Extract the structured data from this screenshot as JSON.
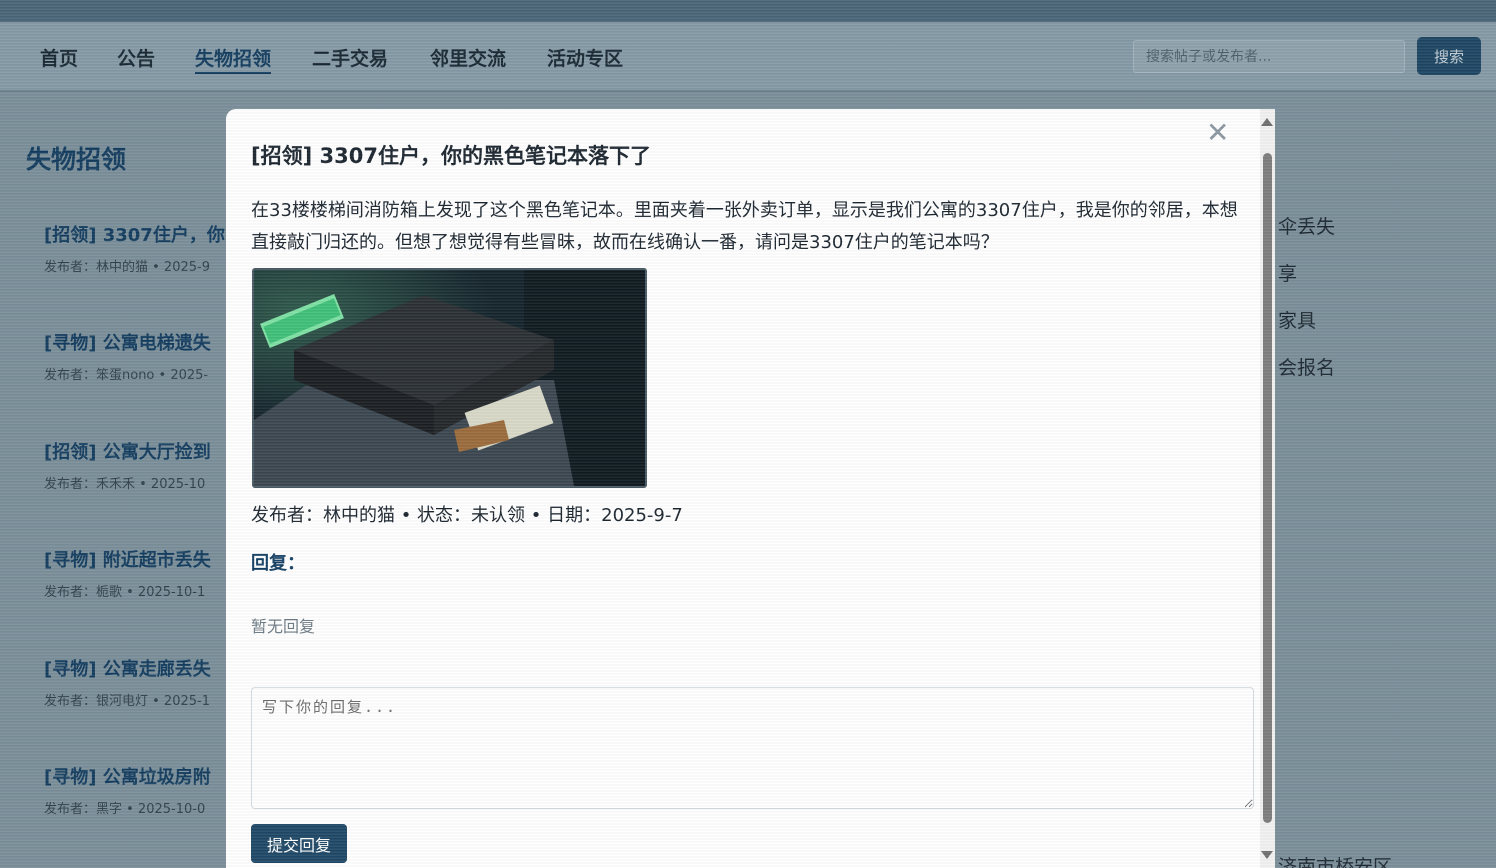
{
  "nav": {
    "items": [
      {
        "label": "首页"
      },
      {
        "label": "公告"
      },
      {
        "label": "失物招领",
        "active": true
      },
      {
        "label": "二手交易"
      },
      {
        "label": "邻里交流"
      },
      {
        "label": "活动专区"
      }
    ],
    "search_placeholder": "搜索帖子或发布者...",
    "search_button": "搜索"
  },
  "page": {
    "title": "失物招领",
    "posts": [
      {
        "title": "[招领] 3307住户，你",
        "meta": "发布者：林中的猫 • 2025-9"
      },
      {
        "title": "[寻物] 公寓电梯遗失",
        "meta": "发布者：笨蛋nono • 2025-"
      },
      {
        "title": "[招领] 公寓大厅捡到",
        "meta": "发布者：禾禾禾 • 2025-10"
      },
      {
        "title": "[寻物] 附近超市丢失",
        "meta": "发布者：栀歌 • 2025-10-1"
      },
      {
        "title": "[寻物] 公寓走廊丢失",
        "meta": "发布者：银河电灯 • 2025-1"
      },
      {
        "title": "[寻物] 公寓垃圾房附",
        "meta": "发布者：黑字 • 2025-10-0"
      }
    ],
    "sidebar": [
      "伞丢失",
      "享",
      "家具",
      "会报名"
    ],
    "sidebar_footer": "济南市桥安区"
  },
  "modal": {
    "close_icon": "close-icon",
    "title": "[招领] 3307住户，你的黑色笔记本落下了",
    "body": "在33楼楼梯间消防箱上发现了这个黑色笔记本。里面夹着一张外卖订单，显示是我们公寓的3307住户，我是你的邻居，本想直接敲门归还的。但想了想觉得有些冒昧，故而在线确认一番，请问是3307住户的笔记本吗？",
    "meta": "发布者：林中的猫 • 状态：未认领 • 日期：2025-9-7",
    "replies_label": "回复：",
    "no_replies": "暂无回复",
    "reply_placeholder": "写下你的回复...",
    "submit_label": "提交回复"
  },
  "colors": {
    "accent": "#143f63",
    "button": "#1f4866",
    "background": "#7f94a0"
  }
}
